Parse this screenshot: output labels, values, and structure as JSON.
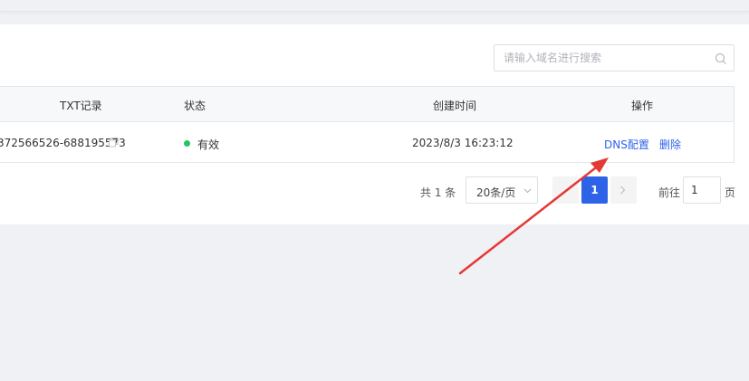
{
  "search": {
    "placeholder": "请输入域名进行搜索",
    "value": ""
  },
  "table": {
    "columns": [
      "TXT记录",
      "状态",
      "创建时间",
      "操作"
    ],
    "rows": [
      {
        "txt_record": "372566526-688195573",
        "status": "有效",
        "created_at": "2023/8/3 16:23:12",
        "actions": {
          "dns_config": "DNS配置",
          "delete": "删除"
        }
      }
    ]
  },
  "pagination": {
    "total_text": "共 1 条",
    "page_size": "20条/页",
    "current_page": "1",
    "goto_label": "前往",
    "goto_value": "1",
    "goto_suffix": "页"
  },
  "colors": {
    "accent": "#2e63e8",
    "status_active": "#22c55e",
    "annotation_arrow": "#e53935"
  }
}
